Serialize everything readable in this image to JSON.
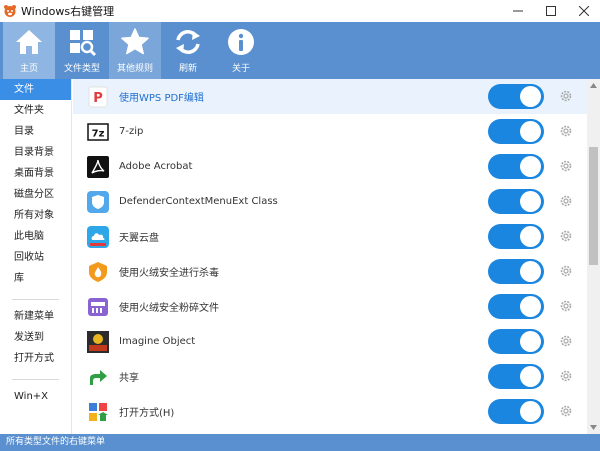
{
  "window": {
    "title": "Windows右键管理",
    "controls": [
      "minimize",
      "maximize",
      "close"
    ]
  },
  "toolbar": {
    "items": [
      {
        "label": "主页",
        "icon": "home-icon"
      },
      {
        "label": "文件类型",
        "icon": "file-types-icon"
      },
      {
        "label": "其他规则",
        "icon": "star-icon"
      },
      {
        "label": "刷新",
        "icon": "refresh-icon"
      },
      {
        "label": "关于",
        "icon": "info-icon"
      }
    ],
    "active_index": 0,
    "selected_index": 2
  },
  "sidebar": {
    "items": [
      "文件",
      "文件夹",
      "目录",
      "目录背景",
      "桌面背景",
      "磁盘分区",
      "所有对象",
      "此电脑",
      "回收站",
      "库"
    ],
    "group2": [
      "新建菜单",
      "发送到",
      "打开方式"
    ],
    "group3": [
      "Win+X"
    ],
    "active_index": 0
  },
  "list": {
    "items": [
      {
        "label": "使用WPS PDF编辑",
        "icon": "wps-pdf-icon",
        "enabled": true
      },
      {
        "label": "7-zip",
        "icon": "7zip-icon",
        "enabled": true
      },
      {
        "label": "Adobe Acrobat",
        "icon": "adobe-acrobat-icon",
        "enabled": true
      },
      {
        "label": "DefenderContextMenuExt Class",
        "icon": "defender-shield-icon",
        "enabled": true
      },
      {
        "label": "天翼云盘",
        "icon": "tianyi-cloud-icon",
        "enabled": true
      },
      {
        "label": "使用火绒安全进行杀毒",
        "icon": "huorong-icon",
        "enabled": true
      },
      {
        "label": "使用火绒安全粉碎文件",
        "icon": "huorong-shredder-icon",
        "enabled": true
      },
      {
        "label": "Imagine Object",
        "icon": "imagine-icon",
        "enabled": true
      },
      {
        "label": "共享",
        "icon": "share-arrow-icon",
        "enabled": true
      },
      {
        "label": "打开方式(H)",
        "icon": "open-with-icon",
        "enabled": true
      }
    ]
  },
  "status": {
    "text": "所有类型文件的右键菜单"
  },
  "colors": {
    "toolbar": "#5a90cf",
    "toggle_on": "#1a86e0",
    "sidebar_active": "#3a8ee6",
    "link": "#1f6fd0"
  }
}
